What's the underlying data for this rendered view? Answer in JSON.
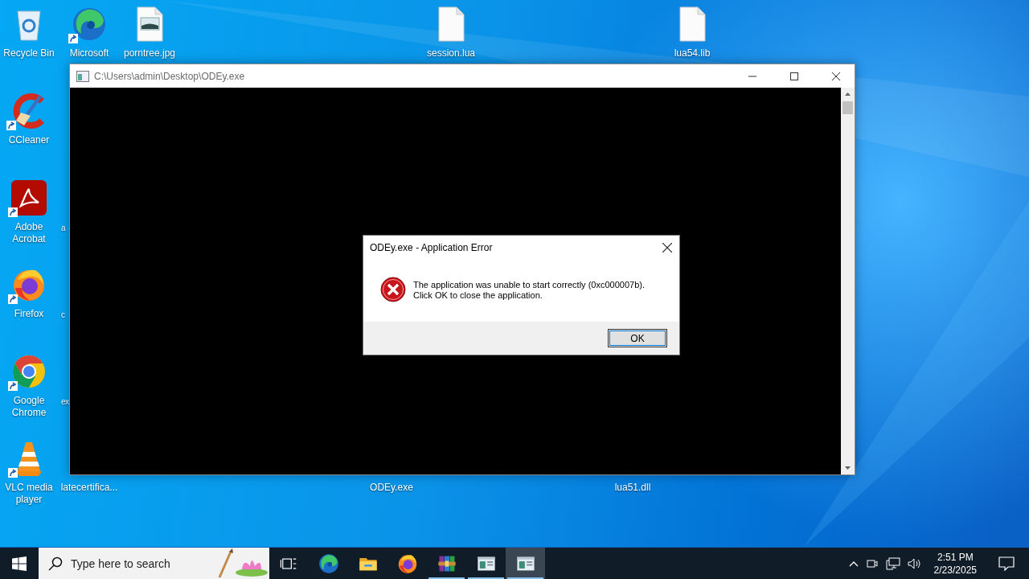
{
  "desktop": {
    "icons": [
      {
        "label": "Recycle Bin",
        "kind": "recycle-bin",
        "shortcut": false
      },
      {
        "label": "Microsoft",
        "kind": "edge",
        "shortcut": true
      },
      {
        "label": "porntree.jpg",
        "kind": "image-file",
        "shortcut": false
      },
      {
        "label": "session.lua",
        "kind": "file",
        "shortcut": false
      },
      {
        "label": "lua54.lib",
        "kind": "file",
        "shortcut": false
      },
      {
        "label": "CCleaner",
        "kind": "ccleaner",
        "shortcut": true
      },
      {
        "label": "Adobe Acrobat",
        "kind": "acrobat",
        "shortcut": true
      },
      {
        "label": "a",
        "kind": "clipped"
      },
      {
        "label": "Firefox",
        "kind": "firefox",
        "shortcut": true
      },
      {
        "label": "c",
        "kind": "clipped"
      },
      {
        "label": "Google Chrome",
        "kind": "chrome",
        "shortcut": true
      },
      {
        "label": "ex",
        "kind": "clipped"
      },
      {
        "label": "VLC media player",
        "kind": "vlc",
        "shortcut": true
      },
      {
        "label": "latecertifica...",
        "kind": "hidden"
      },
      {
        "label": "ODEy.exe",
        "kind": "hidden"
      },
      {
        "label": "lua51.dll",
        "kind": "hidden"
      }
    ]
  },
  "console_window": {
    "title": "C:\\Users\\admin\\Desktop\\ODEy.exe"
  },
  "dialog": {
    "title": "ODEy.exe - Application Error",
    "message": [
      "The application was unable to start correctly (0xc000007b).",
      "Click OK to close the application."
    ],
    "button": "OK"
  },
  "taskbar": {
    "search": {
      "placeholder": "Type here to search"
    },
    "items": [
      {
        "kind": "task-view",
        "running": false,
        "selected": false
      },
      {
        "kind": "edge",
        "running": false,
        "selected": false
      },
      {
        "kind": "explorer",
        "running": false,
        "selected": false
      },
      {
        "kind": "firefox",
        "running": false,
        "selected": false
      },
      {
        "kind": "winrar",
        "running": true,
        "selected": false
      },
      {
        "kind": "console",
        "running": true,
        "selected": false
      },
      {
        "kind": "console",
        "running": true,
        "selected": true
      }
    ],
    "clock": {
      "time": "2:51 PM",
      "date": "2/23/2025"
    }
  }
}
